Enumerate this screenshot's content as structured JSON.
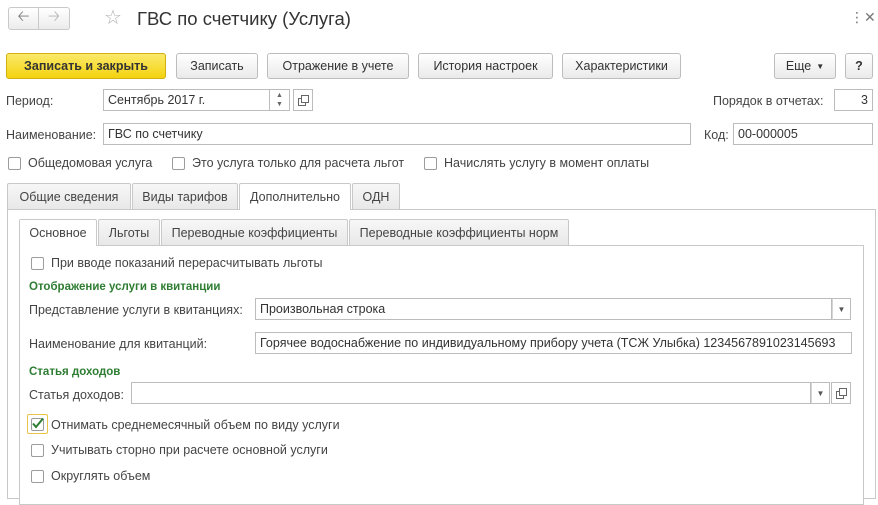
{
  "window": {
    "title": "ГВС по счетчику (Услуга)",
    "back_icon": "arrow-left",
    "forward_icon": "arrow-right",
    "favorite_icon": "star",
    "menu_icon": "vertical-dots",
    "close_icon": "close"
  },
  "toolbar": {
    "save_close": "Записать и закрыть",
    "save": "Записать",
    "accounting": "Отражение в учете",
    "history": "История настроек",
    "characteristics": "Характеристики",
    "more": "Еще",
    "help": "?"
  },
  "form": {
    "period_label": "Период:",
    "period_value": "Сентябрь 2017 г.",
    "order_label": "Порядок в отчетах:",
    "order_value": "3",
    "name_label": "Наименование:",
    "name_value": "ГВС по счетчику",
    "code_label": "Код:",
    "code_value": "00-000005",
    "checkboxes": {
      "common_house": "Общедомовая услуга",
      "benefits_only": "Это услуга только для расчета льгот",
      "charge_on_payment": "Начислять услугу в момент оплаты"
    }
  },
  "tabs": [
    "Общие сведения",
    "Виды тарифов",
    "Дополнительно",
    "ОДН"
  ],
  "subtabs": [
    "Основное",
    "Льготы",
    "Переводные коэффициенты",
    "Переводные коэффициенты норм"
  ],
  "content": {
    "recalc_benefits": "При вводе показаний перерасчитывать льготы",
    "receipt_section": "Отображение услуги в квитанции",
    "receipt_repr_label": "Представление услуги в квитанциях:",
    "receipt_repr_value": "Произвольная строка",
    "receipt_name_label": "Наименование для квитанций:",
    "receipt_name_value": "Горячее водоснабжение по индивидуальному прибору учета (ТСЖ Улыбка) 1234567891023145693",
    "income_section": "Статья доходов",
    "income_label": "Статья доходов:",
    "income_value": "",
    "subtract_avg": "Отнимать среднемесячный объем по виду услуги",
    "storno": "Учитывать сторно при расчете основной услуги",
    "round_volume": "Округлять объем"
  },
  "colors": {
    "primary_button": "#f4d30f",
    "section_text": "#2e7d32",
    "checkmark": "#2e7d32"
  }
}
